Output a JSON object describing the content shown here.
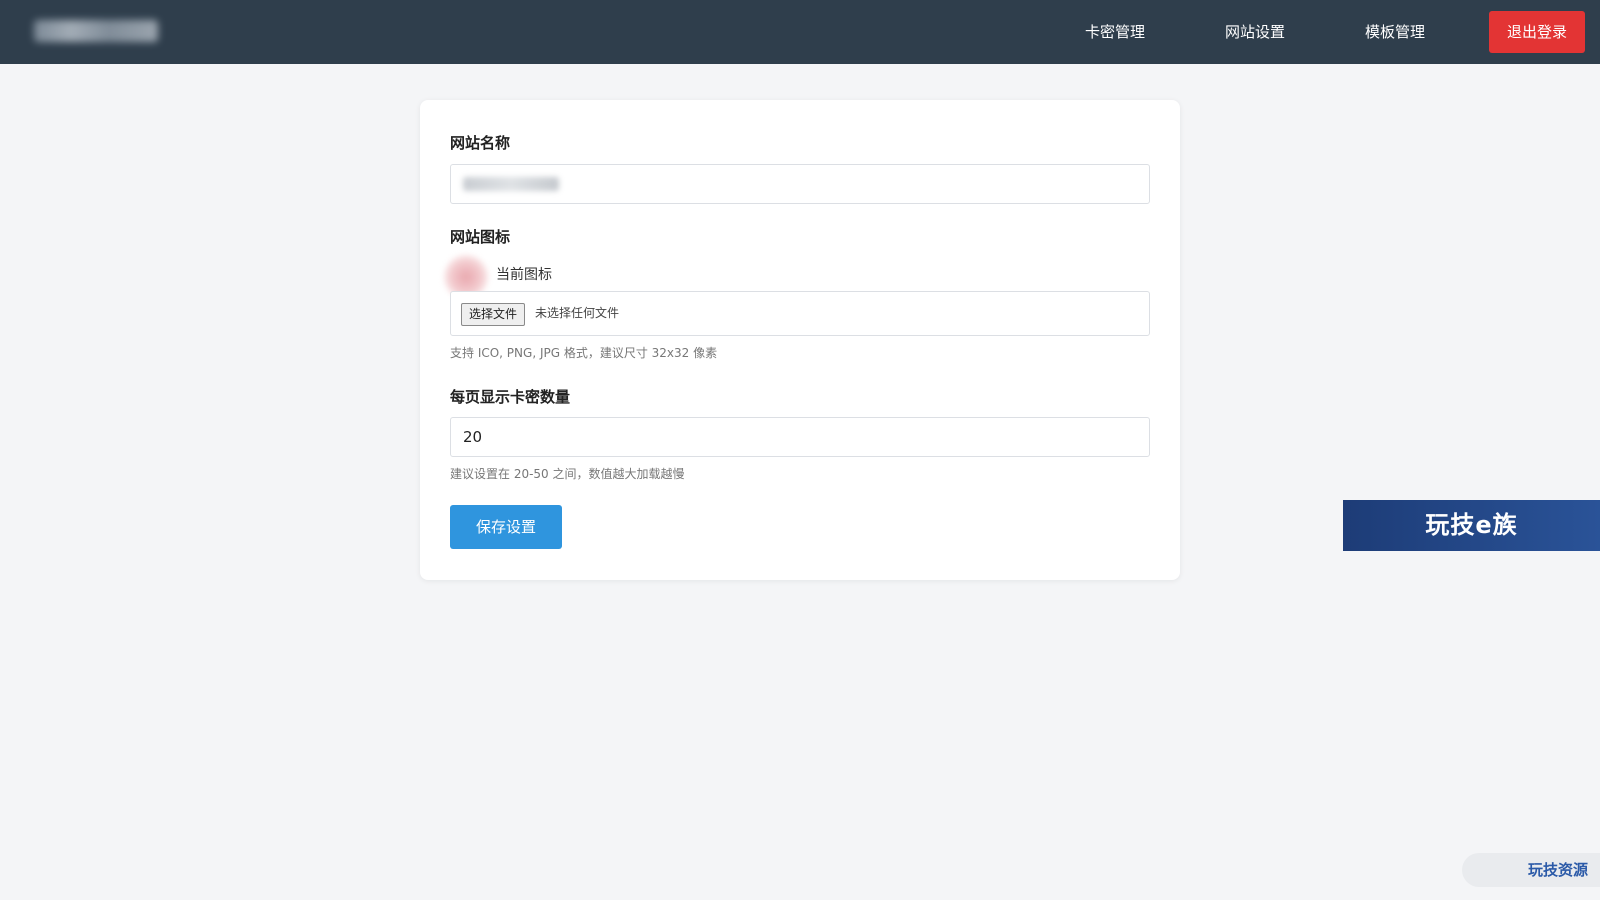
{
  "header": {
    "nav": {
      "cards": "卡密管理",
      "site_settings": "网站设置",
      "templates": "模板管理"
    },
    "logout_label": "退出登录"
  },
  "form": {
    "site_name_label": "网站名称",
    "site_icon_label": "网站图标",
    "current_icon_label": "当前图标",
    "file_button_label": "选择文件",
    "file_status": "未选择任何文件",
    "icon_hint": "支持 ICO, PNG, JPG 格式，建议尺寸 32x32 像素",
    "per_page_label": "每页显示卡密数量",
    "per_page_value": "20",
    "per_page_hint": "建议设置在 20-50 之间，数值越大加载越慢",
    "save_label": "保存设置"
  },
  "watermarks": {
    "banner": "玩技e族",
    "corner": "玩技资源"
  },
  "colors": {
    "header_bg": "#2f3e4c",
    "logout_bg": "#e33434",
    "save_bg": "#2f95de",
    "page_bg": "#f4f5f7"
  }
}
